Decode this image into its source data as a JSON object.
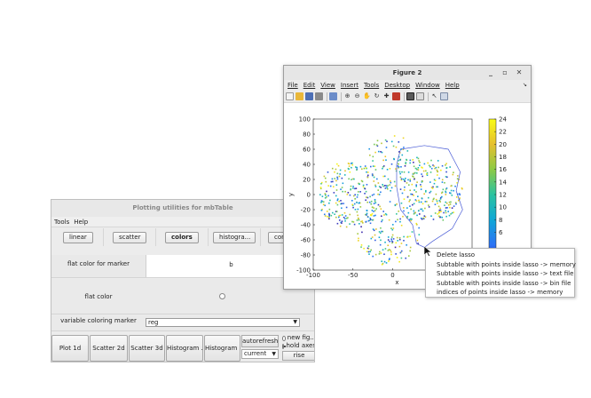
{
  "plot_window": {
    "title": "Plotting utilities for mbTable",
    "menu": [
      "Tools",
      "Help"
    ],
    "toolbar_buttons": [
      "linear",
      "scatter",
      "colors",
      "histogra...",
      "con"
    ],
    "rows": {
      "marker_label": "flat color for marker",
      "marker_value": "b",
      "flat_color_label": "flat color",
      "variable_label": "variable coloring marker",
      "variable_value": "reg"
    },
    "bottom": {
      "plot1d": "Plot 1d",
      "scatter2d": "Scatter 2d",
      "scatter3d": "Scatter 3d",
      "histogram1": "Histogram ...",
      "histogram2": "Histogram ...",
      "autorefresh": "autorefresh",
      "current": "current",
      "new_fig": "new fig...",
      "hold_axes": "hold axes",
      "rise": "rise"
    }
  },
  "figure_window": {
    "title": "Figure 2",
    "menu": [
      "File",
      "Edit",
      "View",
      "Insert",
      "Tools",
      "Desktop",
      "Window",
      "Help"
    ],
    "window_controls": [
      "minimize-icon",
      "maximize-icon",
      "close-icon"
    ],
    "icons": [
      "new-figure-icon",
      "open-file-icon",
      "save-icon",
      "print-icon",
      "print-preview-icon",
      "zoom-in-icon",
      "zoom-out-icon",
      "pan-icon",
      "rotate-icon",
      "data-cursor-icon",
      "brush-icon",
      "colorbar-icon",
      "legend-icon",
      "pointer-icon",
      "dock-icon"
    ]
  },
  "chart_data": {
    "type": "scatter",
    "xlabel": "x",
    "ylabel": "y",
    "xlim": [
      -100,
      100
    ],
    "ylim": [
      -100,
      100
    ],
    "x_ticks": [
      "-100",
      "-50",
      "0",
      "50"
    ],
    "y_ticks": [
      "100",
      "80",
      "60",
      "40",
      "20",
      "0",
      "-20",
      "-40",
      "-60",
      "-80",
      "-100"
    ],
    "colorbar": {
      "range": [
        0,
        24
      ],
      "ticks": [
        "24",
        "22",
        "20",
        "18",
        "16",
        "14",
        "12",
        "10",
        "8",
        "6"
      ],
      "colors": [
        "#3e26a8",
        "#2c73f5",
        "#0fa7d6",
        "#2bc3a0",
        "#8dca45",
        "#e6c02e",
        "#f9fb14"
      ]
    },
    "clusters": [
      {
        "center": [
          -55,
          0
        ],
        "radius": 40,
        "n": 230
      },
      {
        "center": [
          0,
          40
        ],
        "radius": 35,
        "n": 120
      },
      {
        "center": [
          50,
          5
        ],
        "radius": 38,
        "n": 210
      },
      {
        "center": [
          -5,
          -50
        ],
        "radius": 40,
        "n": 150
      }
    ],
    "lasso": [
      [
        10,
        60
      ],
      [
        40,
        65
      ],
      [
        70,
        60
      ],
      [
        85,
        30
      ],
      [
        80,
        5
      ],
      [
        88,
        -20
      ],
      [
        75,
        -45
      ],
      [
        50,
        -62
      ],
      [
        40,
        -70
      ],
      [
        30,
        -65
      ],
      [
        25,
        -40
      ],
      [
        10,
        -20
      ],
      [
        5,
        10
      ],
      [
        5,
        40
      ],
      [
        10,
        60
      ]
    ]
  },
  "context_menu": {
    "items": [
      "Delete lasso",
      "Subtable with points inside lasso -> memory",
      "Subtable with points inside lasso -> text file",
      "Subtable with points inside lasso -> bin file",
      "indices of points inside lasso -> memory"
    ]
  }
}
